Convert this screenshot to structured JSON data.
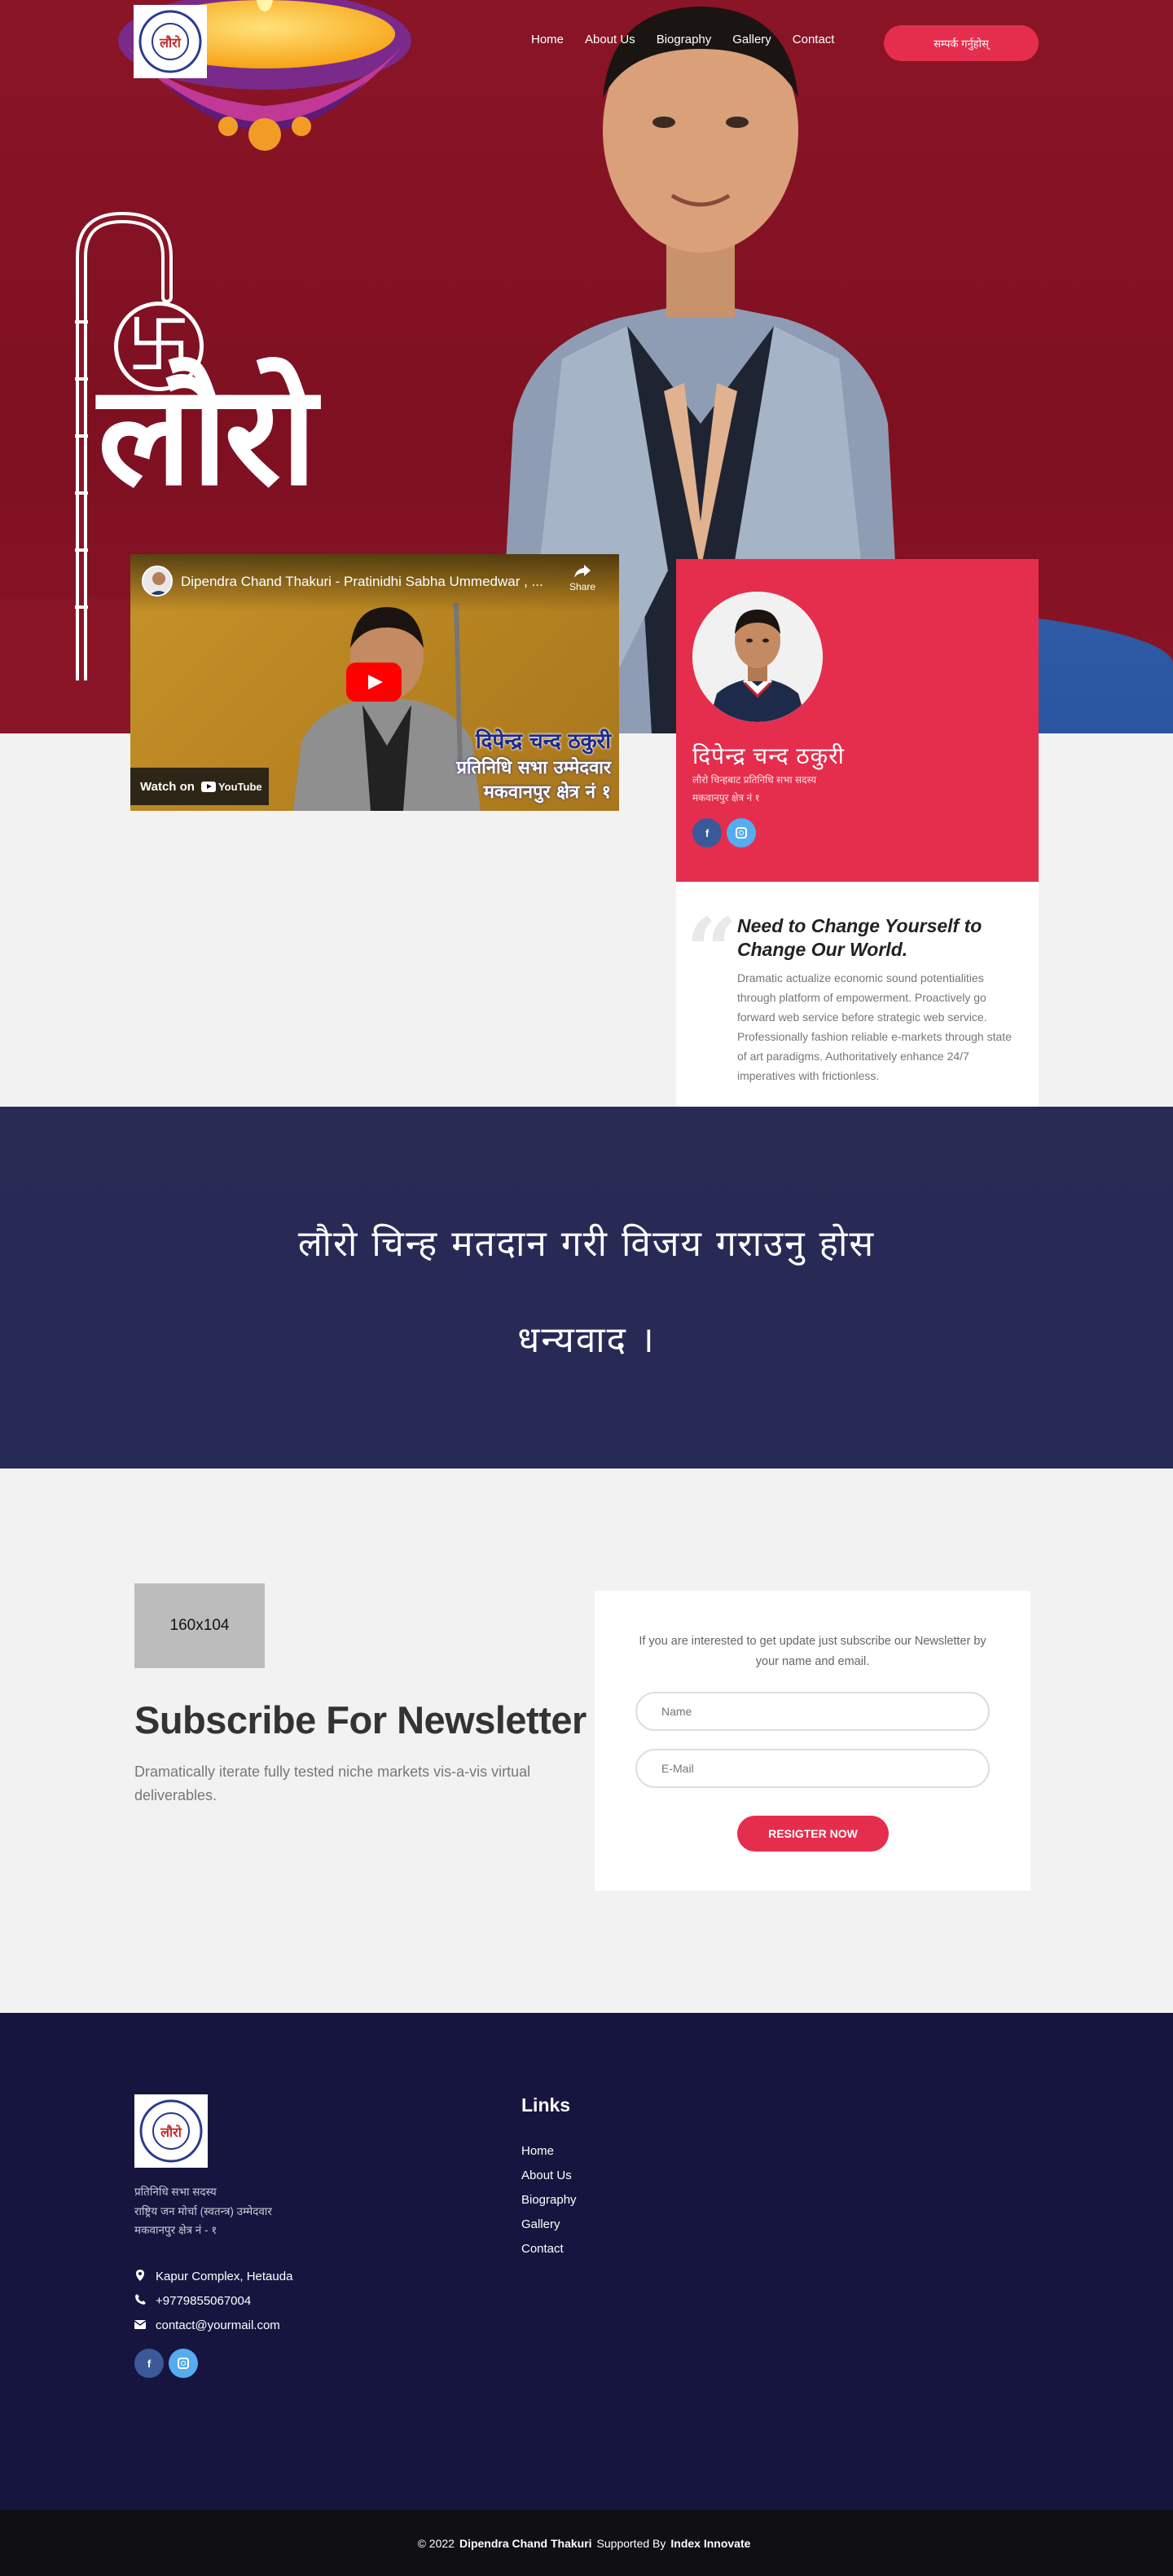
{
  "nav": {
    "logo_text": "लौरो",
    "links": [
      "Home",
      "About Us",
      "Biography",
      "Gallery",
      "Contact"
    ],
    "cta_label": "सम्पर्क गर्नुहोस्"
  },
  "hero": {
    "headline": "लौरो"
  },
  "video": {
    "title": "Dipendra Chand Thakuri - Pratinidhi Sabha Ummedwar , ...",
    "share_label": "Share",
    "caption_line1": "दिपेन्द्र चन्द ठकुरी",
    "caption_line2": "प्रतिनिधि सभा उम्मेदवार",
    "caption_line3": "मकवानपुर क्षेत्र नं १",
    "watch_label": "Watch on",
    "youtube_label": "YouTube"
  },
  "profile": {
    "name": "दिपेन्द्र चन्द ठकुरी",
    "subtitle1": "लौरो चिन्हबाट प्रतिनिधि सभा सदस्य",
    "subtitle2": "मकवानपुर क्षेत्र नं १"
  },
  "quote": {
    "title": "Need to Change Yourself to Change Our World.",
    "text": "Dramatic actualize economic sound potentialities through platform of empowerment. Proactively go forward web service before strategic web service. Professionally fashion reliable e-markets through state of art paradigms. Authoritatively enhance 24/7 imperatives with frictionless."
  },
  "banner": {
    "line1": "लौरो चिन्ह मतदान गरी विजय गराउनु होस",
    "line2": "धन्यवाद ।"
  },
  "newsletter": {
    "image_label": "160x104",
    "title": "Subscribe For Newsletter",
    "description": "Dramatically iterate fully tested niche markets vis-a-vis virtual deliverables.",
    "intro": "If you are interested to get update just subscribe our Newsletter by your name and email.",
    "name_placeholder": "Name",
    "email_placeholder": "E-Mail",
    "button_label": "Resigter Now"
  },
  "footer": {
    "desc_line1": "प्रतिनिधि सभा सदस्य",
    "desc_line2": "राष्ट्रिय जन मोर्चा (स्वतन्त्र) उम्मेदवार",
    "desc_line3": "मकवानपुर क्षेत्र नं - १",
    "address": "Kapur Complex, Hetauda",
    "phone": "+9779855067004",
    "email": "contact@yourmail.com",
    "links_title": "Links",
    "links": [
      "Home",
      "About Us",
      "Biography",
      "Gallery",
      "Contact"
    ]
  },
  "bottom": {
    "copyright": "© 2022",
    "owner": "Dipendra Chand Thakuri",
    "supported_by": "Supported By",
    "company": "Index Innovate"
  },
  "colors": {
    "accent": "#e52e4d",
    "hero_red": "#7e1022",
    "banner_navy": "#292b55",
    "footer_navy": "#161540",
    "facebook": "#3b5998",
    "instagram": "#55acee"
  }
}
